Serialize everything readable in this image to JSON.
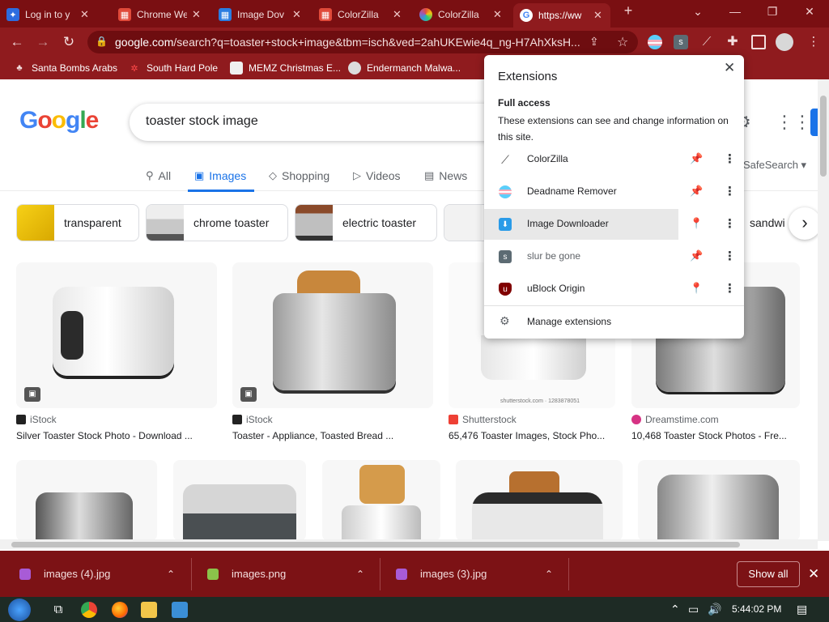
{
  "tabs": [
    {
      "title": "Log in to y",
      "fav_color": "#ffffff"
    },
    {
      "title": "Chrome We",
      "fav_color": "#e04a3a"
    },
    {
      "title": "Image Dov",
      "fav_color": "#2a7de1"
    },
    {
      "title": "ColorZilla",
      "fav_color": "#e04a3a"
    },
    {
      "title": "ColorZilla",
      "fav_color": "#9b59b6"
    },
    {
      "title": "https://ww",
      "fav_color": "#ffffff"
    }
  ],
  "address": {
    "host": "google.com",
    "path": "/search?q=toaster+stock+image&tbm=isch&ved=2ahUKEwie4q_ng-H7AhXksH..."
  },
  "bookmarks": [
    {
      "label": "Santa Bombs Arabs"
    },
    {
      "label": "South Hard Pole"
    },
    {
      "label": "MEMZ Christmas E..."
    },
    {
      "label": "Endermanch Malwa..."
    }
  ],
  "search": {
    "query": "toaster stock image",
    "logo": "Google",
    "safesearch": "SafeSearch ▾"
  },
  "nav_tabs": [
    {
      "label": "All",
      "icon": "🔍"
    },
    {
      "label": "Images",
      "icon": "▣"
    },
    {
      "label": "Shopping",
      "icon": "◇"
    },
    {
      "label": "Videos",
      "icon": "▶"
    },
    {
      "label": "News",
      "icon": "▤"
    }
  ],
  "chips": [
    {
      "label": "transparent"
    },
    {
      "label": "chrome toaster"
    },
    {
      "label": "electric toaster"
    },
    {
      "label": "sandwi"
    }
  ],
  "results": [
    {
      "source": "iStock",
      "title": "Silver Toaster Stock Photo - Download ..."
    },
    {
      "source": "iStock",
      "title": "Toaster - Appliance, Toasted Bread ..."
    },
    {
      "source": "Shutterstock",
      "title": "65,476 Toaster Images, Stock Pho..."
    },
    {
      "source": "Dreamstime.com",
      "title": "10,468 Toaster Stock Photos - Fre..."
    }
  ],
  "watermark": "shutterstock.com · 1283878051",
  "extensions_popup": {
    "title": "Extensions",
    "full_access": "Full access",
    "description": "These extensions can see and change information on this site.",
    "items": [
      {
        "name": "ColorZilla",
        "pinned": true
      },
      {
        "name": "Deadname Remover",
        "pinned": true
      },
      {
        "name": "Image Downloader",
        "pinned": false
      },
      {
        "name": "slur be gone",
        "pinned": true
      },
      {
        "name": "uBlock Origin",
        "pinned": false
      }
    ],
    "manage": "Manage extensions"
  },
  "downloads": [
    {
      "name": "images (4).jpg"
    },
    {
      "name": "images.png"
    },
    {
      "name": "images (3).jpg"
    }
  ],
  "show_all": "Show all",
  "clock": "5:44:02 PM",
  "colors": {
    "theme_red": "#8f1b1e",
    "google_blue": "#1a73e8",
    "pin_blue": "#1a5fc8"
  }
}
